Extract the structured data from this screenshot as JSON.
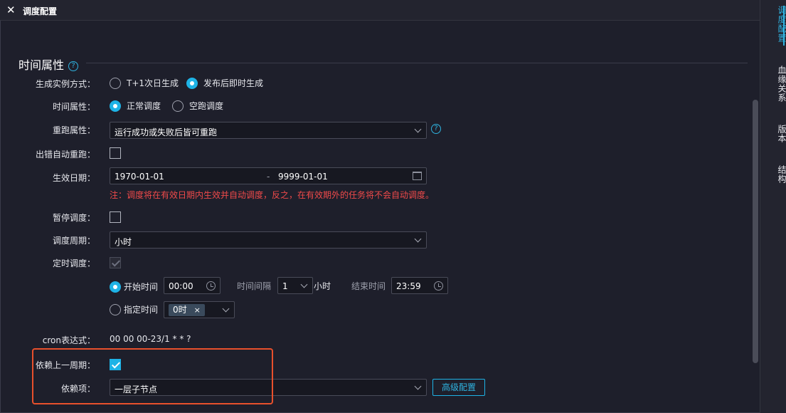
{
  "window": {
    "title": "调度配置"
  },
  "section": {
    "title": "时间属性",
    "help_icon": "question-circle-icon"
  },
  "fields": {
    "instance_mode": {
      "label": "生成实例方式：",
      "options": [
        "T+1次日生成",
        "发布后即时生成"
      ],
      "selected": "发布后即时生成"
    },
    "time_attr": {
      "label": "时间属性：",
      "options": [
        "正常调度",
        "空跑调度"
      ],
      "selected": "正常调度"
    },
    "rerun": {
      "label": "重跑属性：",
      "value": "运行成功或失败后皆可重跑"
    },
    "auto_rerun": {
      "label": "出错自动重跑：",
      "checked": false
    },
    "effective_date": {
      "label": "生效日期：",
      "start": "1970-01-01",
      "separator": "-",
      "end": "9999-01-01",
      "note": "注：调度将在有效日期内生效并自动调度，反之，在有效期外的任务将不会自动调度。"
    },
    "pause": {
      "label": "暂停调度：",
      "checked": false
    },
    "cycle": {
      "label": "调度周期：",
      "value": "小时"
    },
    "timed": {
      "label": "定时调度：",
      "checked": true,
      "start_option": "开始时间",
      "start_value": "00:00",
      "interval_label": "时间间隔",
      "interval_value": "1",
      "interval_unit": "小时",
      "end_label": "结束时间",
      "end_value": "23:59",
      "specified_option": "指定时间",
      "specified_tag": "0时",
      "tag_close": "×"
    },
    "cron": {
      "label": "cron表达式：",
      "value": "00 00 00-23/1 * * ?"
    },
    "depend_prev": {
      "label": "依赖上一周期：",
      "checked": true
    },
    "depend_item": {
      "label": "依赖项：",
      "value": "一层子节点",
      "advanced_button": "高级配置"
    }
  },
  "right_rail": {
    "items": [
      "调度配置",
      "血缘关系",
      "版本",
      "结构"
    ],
    "active": "调度配置"
  },
  "colors": {
    "accent": "#1eb3e6",
    "warning": "#ef4a4a",
    "highlight": "#e8502c"
  }
}
